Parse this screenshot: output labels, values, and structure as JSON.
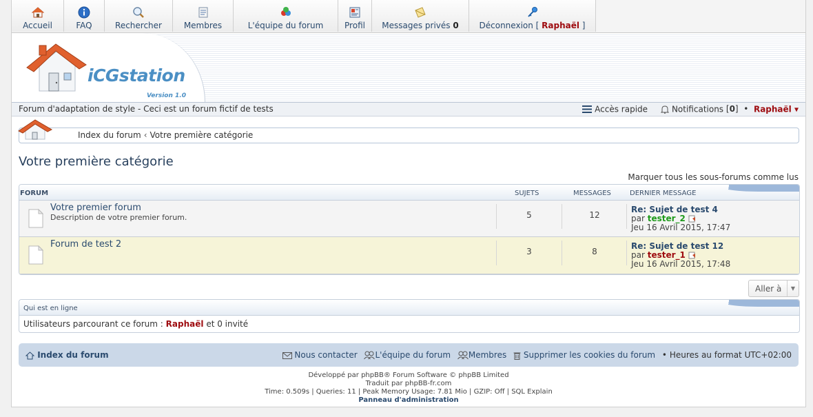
{
  "nav": {
    "accueil": "Accueil",
    "faq": "FAQ",
    "rechercher": "Rechercher",
    "membres": "Membres",
    "equipe": "L'équipe du forum",
    "profil": "Profil",
    "messages_label": "Messages privés",
    "messages_count": "0",
    "deconnexion_label": "Déconnexion",
    "username": "Raphaël"
  },
  "header": {
    "logo_text": "iCGstation",
    "logo_version": "Version 1.0"
  },
  "subbar": {
    "site_desc": "Forum d'adaptation de style - Ceci est un forum fictif de tests",
    "quick_access": "Accès rapide",
    "notifications_label": "Notifications",
    "notifications_count": "0",
    "username": "Raphaël"
  },
  "breadcrumb": {
    "index": "Index du forum",
    "category": "Votre première catégorie"
  },
  "page": {
    "title": "Votre première catégorie",
    "mark_read": "Marquer tous les sous-forums comme lus"
  },
  "table": {
    "col_forum": "FORUM",
    "col_topics": "SUJETS",
    "col_posts": "MESSAGES",
    "col_last": "DERNIER MESSAGE",
    "rows": [
      {
        "title": "Votre premier forum",
        "desc": "Description de votre premier forum.",
        "topics": "5",
        "posts": "12",
        "last_title": "Re: Sujet de test 4",
        "by": "par",
        "last_user": "tester_2",
        "last_date": "Jeu 16 Avril 2015, 17:47"
      },
      {
        "title": "Forum de test 2",
        "desc": "",
        "topics": "3",
        "posts": "8",
        "last_title": "Re: Sujet de test 12",
        "by": "par",
        "last_user": "tester_1",
        "last_date": "Jeu 16 Avril 2015, 17:48"
      }
    ]
  },
  "jump": {
    "label": "Aller à"
  },
  "online": {
    "title": "Qui est en ligne",
    "text_prefix": "Utilisateurs parcourant ce forum :",
    "user": "Raphaël",
    "text_suffix": "et 0 invité"
  },
  "footer": {
    "index": "Index du forum",
    "contact": "Nous contacter",
    "team": "L'équipe du forum",
    "members": "Membres",
    "delete_cookies": "Supprimer les cookies du forum",
    "timezone": "Heures au format UTC+02:00",
    "line1": "Développé par phpBB® Forum Software © phpBB Limited",
    "line2": "Traduit par phpBB-fr.com",
    "line3": "Time: 0.509s | Queries: 11 | Peak Memory Usage: 7.81 Mio | GZIP: Off | SQL Explain",
    "admin": "Panneau d'administration"
  }
}
